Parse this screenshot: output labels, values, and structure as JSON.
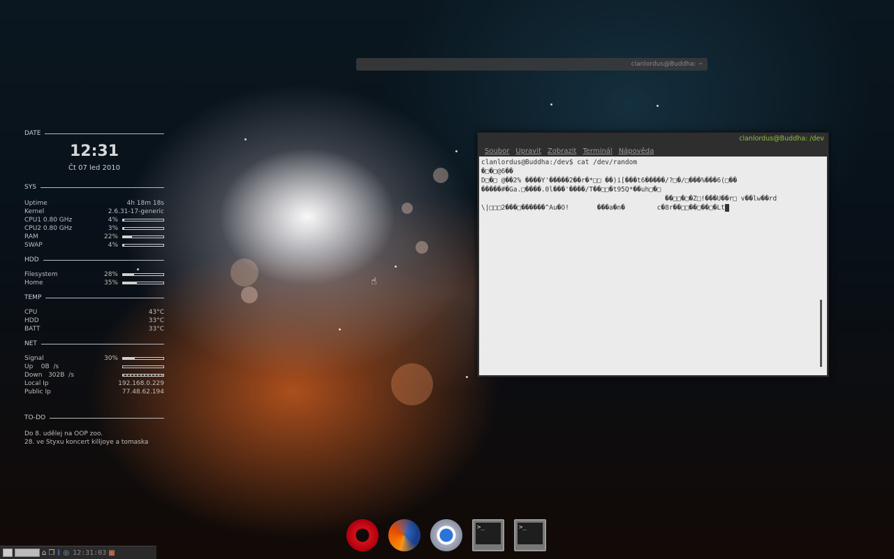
{
  "inactive_window": {
    "title": "clanlordus@Buddha: ~"
  },
  "terminal": {
    "title": "clanlordus@Buddha: /dev",
    "menu": [
      "Soubor",
      "Upravit",
      "Zobrazit",
      "Terminál",
      "Nápověda"
    ],
    "lines": [
      "clanlordus@Buddha:/dev$ cat /dev/random",
      "�□�□@6��",
      "D□�□ @��2% ����Y'�����2��r�*□□ ��)i[���t6�����/?□�/□���%���6(□��",
      "�����#�Ga.□����.0l���'����/T��□□�t95Q*��uh□�□",
      "                                              ��□□�□�Z□!���U��r□ v��lw��rd",
      "\\|□□□2���□������^Au�O!       ���a�n�        c�8r��□□��□��□�Lt"
    ]
  },
  "conky": {
    "date": {
      "heading": "DATE",
      "time": "12:31",
      "day": "Čt 07 led 2010"
    },
    "sys": {
      "heading": "SYS",
      "uptime_label": "Uptime",
      "uptime": "4h 18m 18s",
      "kernel_label": "Kernel",
      "kernel": "2.6.31-17-generic",
      "rows": [
        {
          "label": "CPU1 0.80 GHz",
          "pct": "4%",
          "value": 4
        },
        {
          "label": "CPU2 0.80 GHz",
          "pct": "3%",
          "value": 3
        },
        {
          "label": "RAM",
          "pct": "22%",
          "value": 22
        },
        {
          "label": "SWAP",
          "pct": "4%",
          "value": 4
        }
      ]
    },
    "hdd": {
      "heading": "HDD",
      "rows": [
        {
          "label": "Filesystem",
          "pct": "28%",
          "value": 28
        },
        {
          "label": "Home",
          "pct": "35%",
          "value": 35
        }
      ]
    },
    "temp": {
      "heading": "TEMP",
      "rows": [
        {
          "label": "CPU",
          "value": "43°C"
        },
        {
          "label": "HDD",
          "value": "33°C"
        },
        {
          "label": "BATT",
          "value": "33°C"
        }
      ]
    },
    "net": {
      "heading": "NET",
      "signal_label": "Signal",
      "signal_pct": "30%",
      "signal": 30,
      "up_label": "Up    0B  /s",
      "down_label": "Down   302B  /s",
      "local_label": "Local Ip",
      "local_ip": "192.168.0.229",
      "public_label": "Public Ip",
      "public_ip": "77.48.62.194"
    },
    "todo": {
      "heading": "TO-DO",
      "items": [
        "Do 8. udělej na OOP zoo.",
        "28. ve Styxu koncert killjoye a tomaska"
      ]
    }
  },
  "dock": {
    "items": [
      "opera-icon",
      "firefox-icon",
      "chromium-icon",
      "terminal-icon",
      "terminal-icon"
    ],
    "term_prompt": ">_"
  },
  "panel": {
    "clock": "12:31:03"
  }
}
